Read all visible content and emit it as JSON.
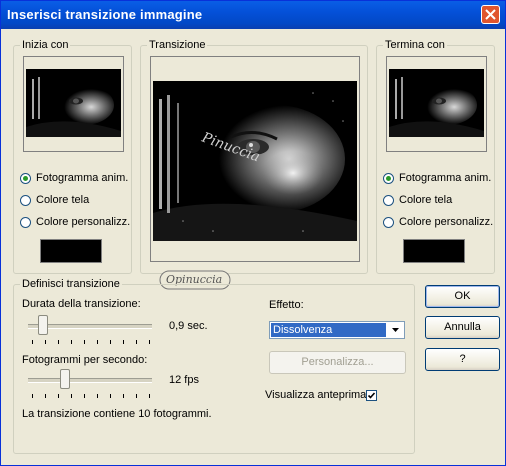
{
  "window": {
    "title": "Inserisci transizione immagine"
  },
  "start_group": {
    "label": "Inizia con",
    "options": [
      "Fotogramma anim.",
      "Colore tela",
      "Colore personalizz."
    ],
    "selected": 0,
    "custom_color": "#000000"
  },
  "transition_group": {
    "label": "Transizione"
  },
  "end_group": {
    "label": "Termina con",
    "options": [
      "Fotogramma anim.",
      "Colore tela",
      "Colore personalizz."
    ],
    "selected": 0,
    "custom_color": "#000000"
  },
  "define_group": {
    "label": "Definisci transizione",
    "duration": {
      "label": "Durata della transizione:",
      "value_text": "0,9 sec."
    },
    "fps": {
      "label": "Fotogrammi per secondo:",
      "value_text": "12 fps"
    },
    "summary": "La transizione contiene 10 fotogrammi.",
    "effect": {
      "label": "Effetto:",
      "value": "Dissolvenza"
    },
    "customize_label": "Personalizza...",
    "preview": {
      "label": "Visualizza anteprima",
      "checked": true
    }
  },
  "buttons": {
    "ok": "OK",
    "cancel": "Annulla",
    "help": "?"
  },
  "watermark": "Opinuccia",
  "preview_image_text": "Pinuccia"
}
